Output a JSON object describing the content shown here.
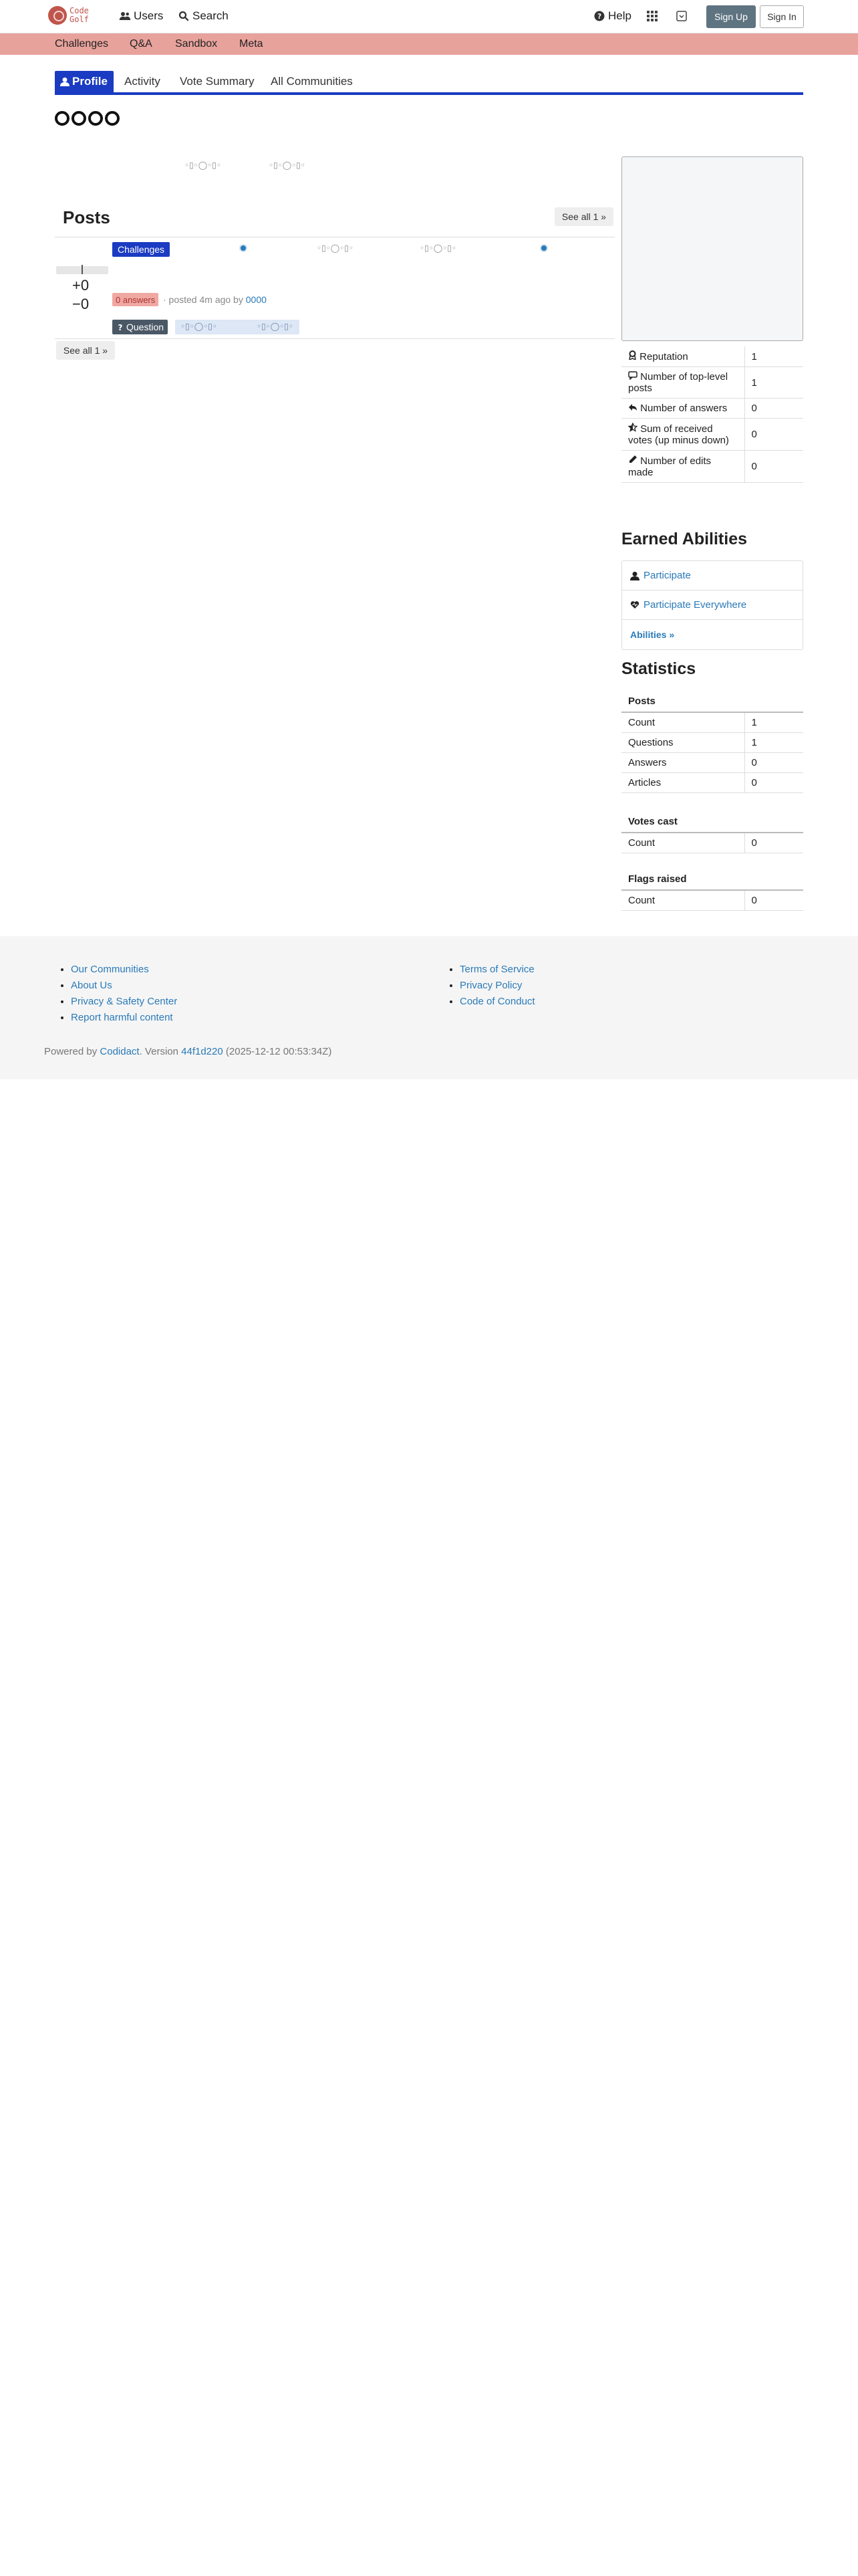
{
  "header": {
    "logo_line1": "Code",
    "logo_line2": "Golf",
    "nav_users": "Users",
    "nav_search": "Search",
    "nav_help": "Help",
    "sign_up": "Sign Up",
    "sign_in": "Sign In"
  },
  "categories": [
    "Challenges",
    "Q&A",
    "Sandbox",
    "Meta"
  ],
  "tabs": {
    "profile": "Profile",
    "activity": "Activity",
    "vote_summary": "Vote Summary",
    "all_communities": "All Communities"
  },
  "posts": {
    "title": "Posts",
    "see_all_top": "See all 1 »",
    "see_all_bottom": "See all 1 »",
    "category_badge": "Challenges",
    "score_up": "+0",
    "score_down": "−0",
    "answers_badge": "0 answers",
    "meta": "· posted 4m ago by",
    "author": "0000",
    "type_badge": "Question"
  },
  "stats_top": [
    {
      "label": "Reputation",
      "value": "1",
      "icon": "award-icon"
    },
    {
      "label": "Number of top-level posts",
      "value": "1",
      "icon": "comment-icon"
    },
    {
      "label": "Number of answers",
      "value": "0",
      "icon": "reply-icon"
    },
    {
      "label": "Sum of received votes (up minus down)",
      "value": "0",
      "icon": "star-half-icon"
    },
    {
      "label": "Number of edits made",
      "value": "0",
      "icon": "pencil-icon"
    }
  ],
  "abilities": {
    "title": "Earned Abilities",
    "items": [
      "Participate",
      "Participate Everywhere"
    ],
    "link": "Abilities »"
  },
  "statistics": {
    "title": "Statistics",
    "posts_header": "Posts",
    "posts_rows": [
      {
        "label": "Count",
        "value": "1"
      },
      {
        "label": "Questions",
        "value": "1"
      },
      {
        "label": "Answers",
        "value": "0"
      },
      {
        "label": "Articles",
        "value": "0"
      }
    ],
    "votes_header": "Votes cast",
    "votes_rows": [
      {
        "label": "Count",
        "value": "0"
      }
    ],
    "flags_header": "Flags raised",
    "flags_rows": [
      {
        "label": "Count",
        "value": "0"
      }
    ]
  },
  "footer": {
    "col1": [
      "Our Communities",
      "About Us",
      "Privacy & Safety Center",
      "Report harmful content"
    ],
    "col2": [
      "Terms of Service",
      "Privacy Policy",
      "Code of Conduct"
    ],
    "powered_prefix": "Powered by",
    "codidact": "Codidact",
    "version_prefix": ". Version",
    "version": "44f1d220",
    "version_date": "(2025-12-12 00:53:34Z)"
  },
  "colors": {
    "accent": "#1a3bc2",
    "category_bar": "#e8a29c",
    "brand": "#c0554b"
  }
}
